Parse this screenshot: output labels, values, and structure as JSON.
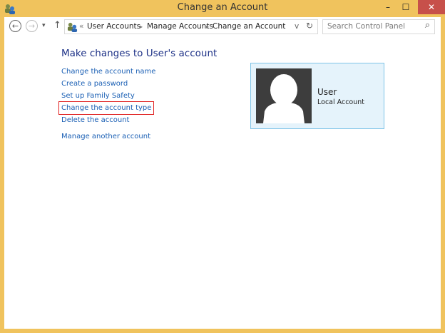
{
  "window": {
    "title": "Change an Account",
    "minimize": "–",
    "maximize": "☐",
    "close": "✕"
  },
  "nav": {
    "back": "←",
    "forward": "→",
    "recent": "▾",
    "up": "↑",
    "refresh": "↻",
    "dropdown": "v"
  },
  "breadcrumb": {
    "overflow": "«",
    "items": [
      "User Accounts",
      "Manage Accounts",
      "Change an Account"
    ],
    "separator": "▸"
  },
  "search": {
    "placeholder": "Search Control Panel",
    "icon": "⌕"
  },
  "main": {
    "heading": "Make changes to User's account",
    "links": [
      "Change the account name",
      "Create a password",
      "Set up Family Safety",
      "Change the account type",
      "Delete the account",
      "Manage another account"
    ],
    "highlighted_link": "Change the account type"
  },
  "account": {
    "name": "User",
    "type": "Local Account"
  },
  "colors": {
    "frame": "#f0c35d",
    "close": "#c7504a",
    "link": "#1a5fb4",
    "heading": "#1e3287",
    "card_bg": "#e5f3fb",
    "card_border": "#7fc4e8"
  }
}
